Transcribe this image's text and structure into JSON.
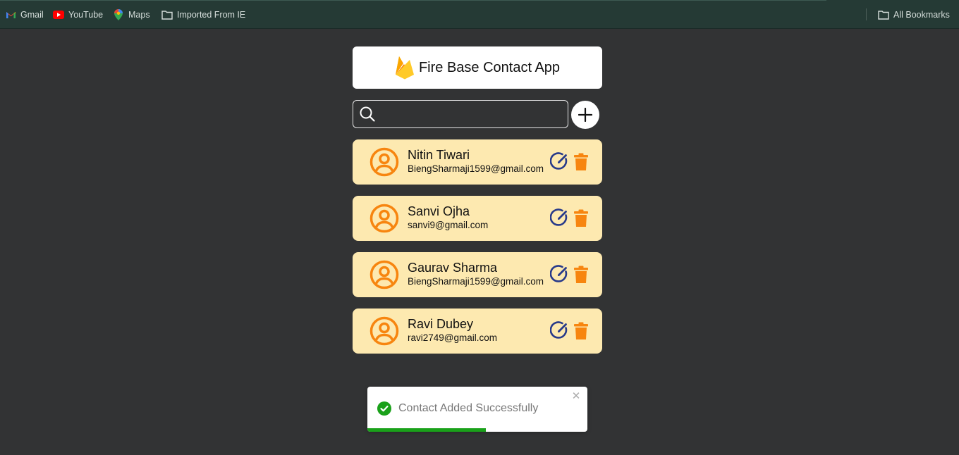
{
  "bookmarks_bar": {
    "items": [
      {
        "label": "Gmail",
        "icon": "gmail-icon"
      },
      {
        "label": "YouTube",
        "icon": "youtube-icon"
      },
      {
        "label": "Maps",
        "icon": "maps-icon"
      },
      {
        "label": "Imported From IE",
        "icon": "folder-icon"
      }
    ],
    "all_bookmarks": {
      "label": "All Bookmarks",
      "icon": "folder-icon"
    }
  },
  "app": {
    "title": "Fire Base Contact App",
    "logo_icon": "firebase-logo-icon",
    "search": {
      "value": "",
      "placeholder": "",
      "icon": "search-icon"
    },
    "add_button_icon": "plus-icon",
    "contacts": [
      {
        "name": "Nitin Tiwari",
        "email": "BiengSharmaji1599@gmail.com"
      },
      {
        "name": "Sanvi Ojha",
        "email": "sanvi9@gmail.com"
      },
      {
        "name": "Gaurav Sharma",
        "email": "BiengSharmaji1599@gmail.com"
      },
      {
        "name": "Ravi Dubey",
        "email": "ravi2749@gmail.com"
      }
    ]
  },
  "toast": {
    "message": "Contact Added Successfully",
    "close_glyph": "✕",
    "progress": 0.54,
    "type": "success"
  },
  "colors": {
    "background": "#323334",
    "card": "#fde9b0",
    "accent_orange": "#f7850f",
    "edit_blue": "#283a8a",
    "success_green": "#1aa11a"
  }
}
